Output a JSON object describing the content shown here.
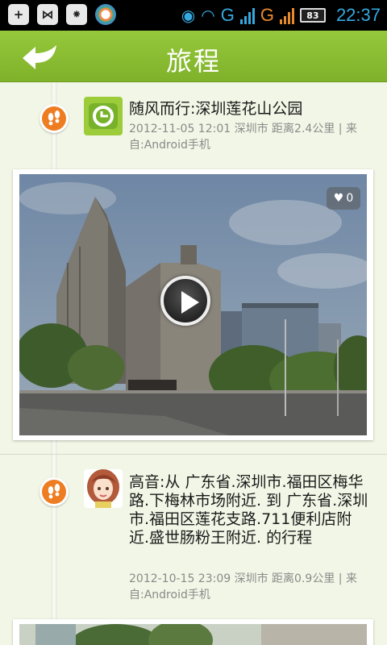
{
  "status_bar": {
    "icons": [
      "usb-icon",
      "share-icon",
      "message-icon",
      "browser-icon"
    ],
    "network_1": "G",
    "network_2": "G",
    "battery": "83",
    "time": "22:37"
  },
  "header": {
    "title": "旅程",
    "back_icon": "back-arrow-icon",
    "accent_color": "#86ba33"
  },
  "posts": [
    {
      "title": "随风而行:深圳莲花山公园",
      "meta": "2012-11-05 12:01 深圳市 距离2.4公里 | 来自:Android手机",
      "likes": "0",
      "has_video": true
    },
    {
      "title": "高音:从 广东省.深圳市.福田区梅华路.下梅林市场附近. 到 广东省.深圳市.福田区莲花支路.711便利店附近.盛世肠粉王附近. 的行程",
      "meta": "2012-10-15 23:09 深圳市 距离0.9公里 | 来自:Android手机"
    }
  ]
}
